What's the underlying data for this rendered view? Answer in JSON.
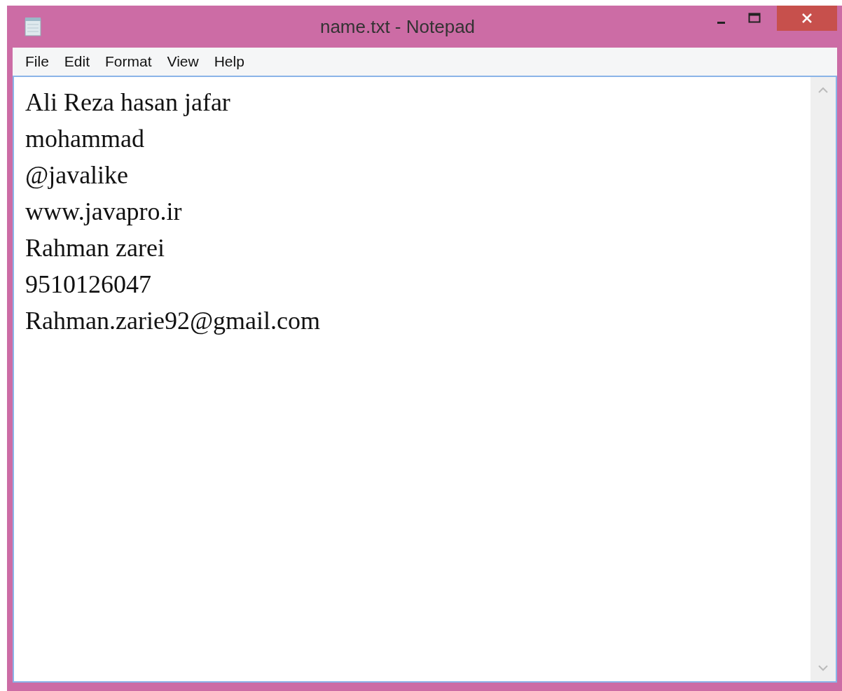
{
  "window": {
    "title": "name.txt - Notepad"
  },
  "menu": [
    "File",
    "Edit",
    "Format",
    "View",
    "Help"
  ],
  "document": {
    "lines": [
      "Ali Reza hasan jafar",
      "mohammad",
      "@javalike",
      "www.javapro.ir",
      "Rahman zarei",
      "9510126047",
      "Rahman.zarie92@gmail.com"
    ]
  }
}
